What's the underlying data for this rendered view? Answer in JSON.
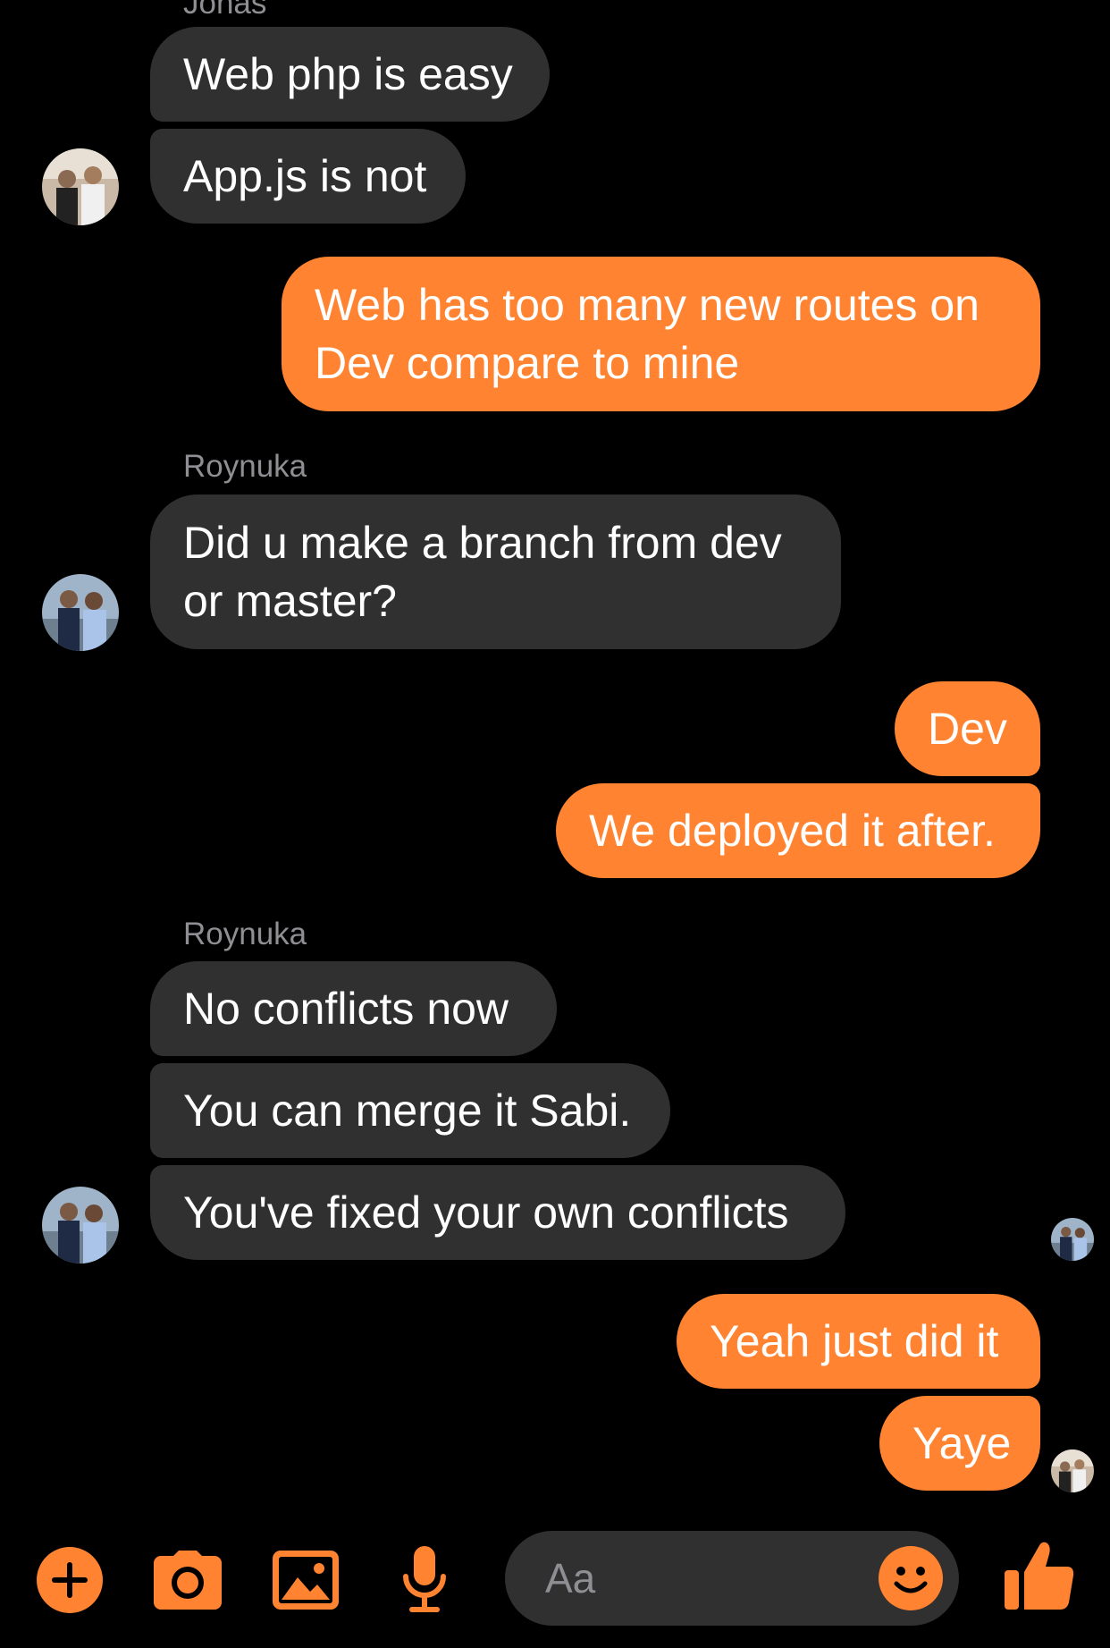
{
  "conversation": {
    "groups": [
      {
        "sender": "Jonas",
        "messages": [
          "Web php is easy",
          "App.js is not"
        ]
      },
      {
        "sender": "me",
        "messages": [
          "Web has too many new routes on Dev compare to mine"
        ]
      },
      {
        "sender": "Roynuka",
        "messages": [
          "Did u make a branch from dev or master?"
        ]
      },
      {
        "sender": "me",
        "messages": [
          "Dev",
          "We deployed it after."
        ]
      },
      {
        "sender": "Roynuka",
        "messages": [
          "No conflicts now",
          "You can merge it Sabi.",
          "You've fixed your own conflicts"
        ]
      },
      {
        "sender": "me",
        "messages": [
          "Yeah just did it",
          "Yaye"
        ]
      }
    ]
  },
  "composer": {
    "placeholder": "Aa",
    "icons": [
      "plus-icon",
      "camera-icon",
      "image-icon",
      "microphone-icon",
      "emoji-icon",
      "thumbs-up-icon"
    ]
  },
  "colors": {
    "background": "#000000",
    "incoming_bubble": "#303030",
    "outgoing_bubble": "#ff8330",
    "accent": "#ff8330",
    "sender_name": "#8e8e93"
  }
}
